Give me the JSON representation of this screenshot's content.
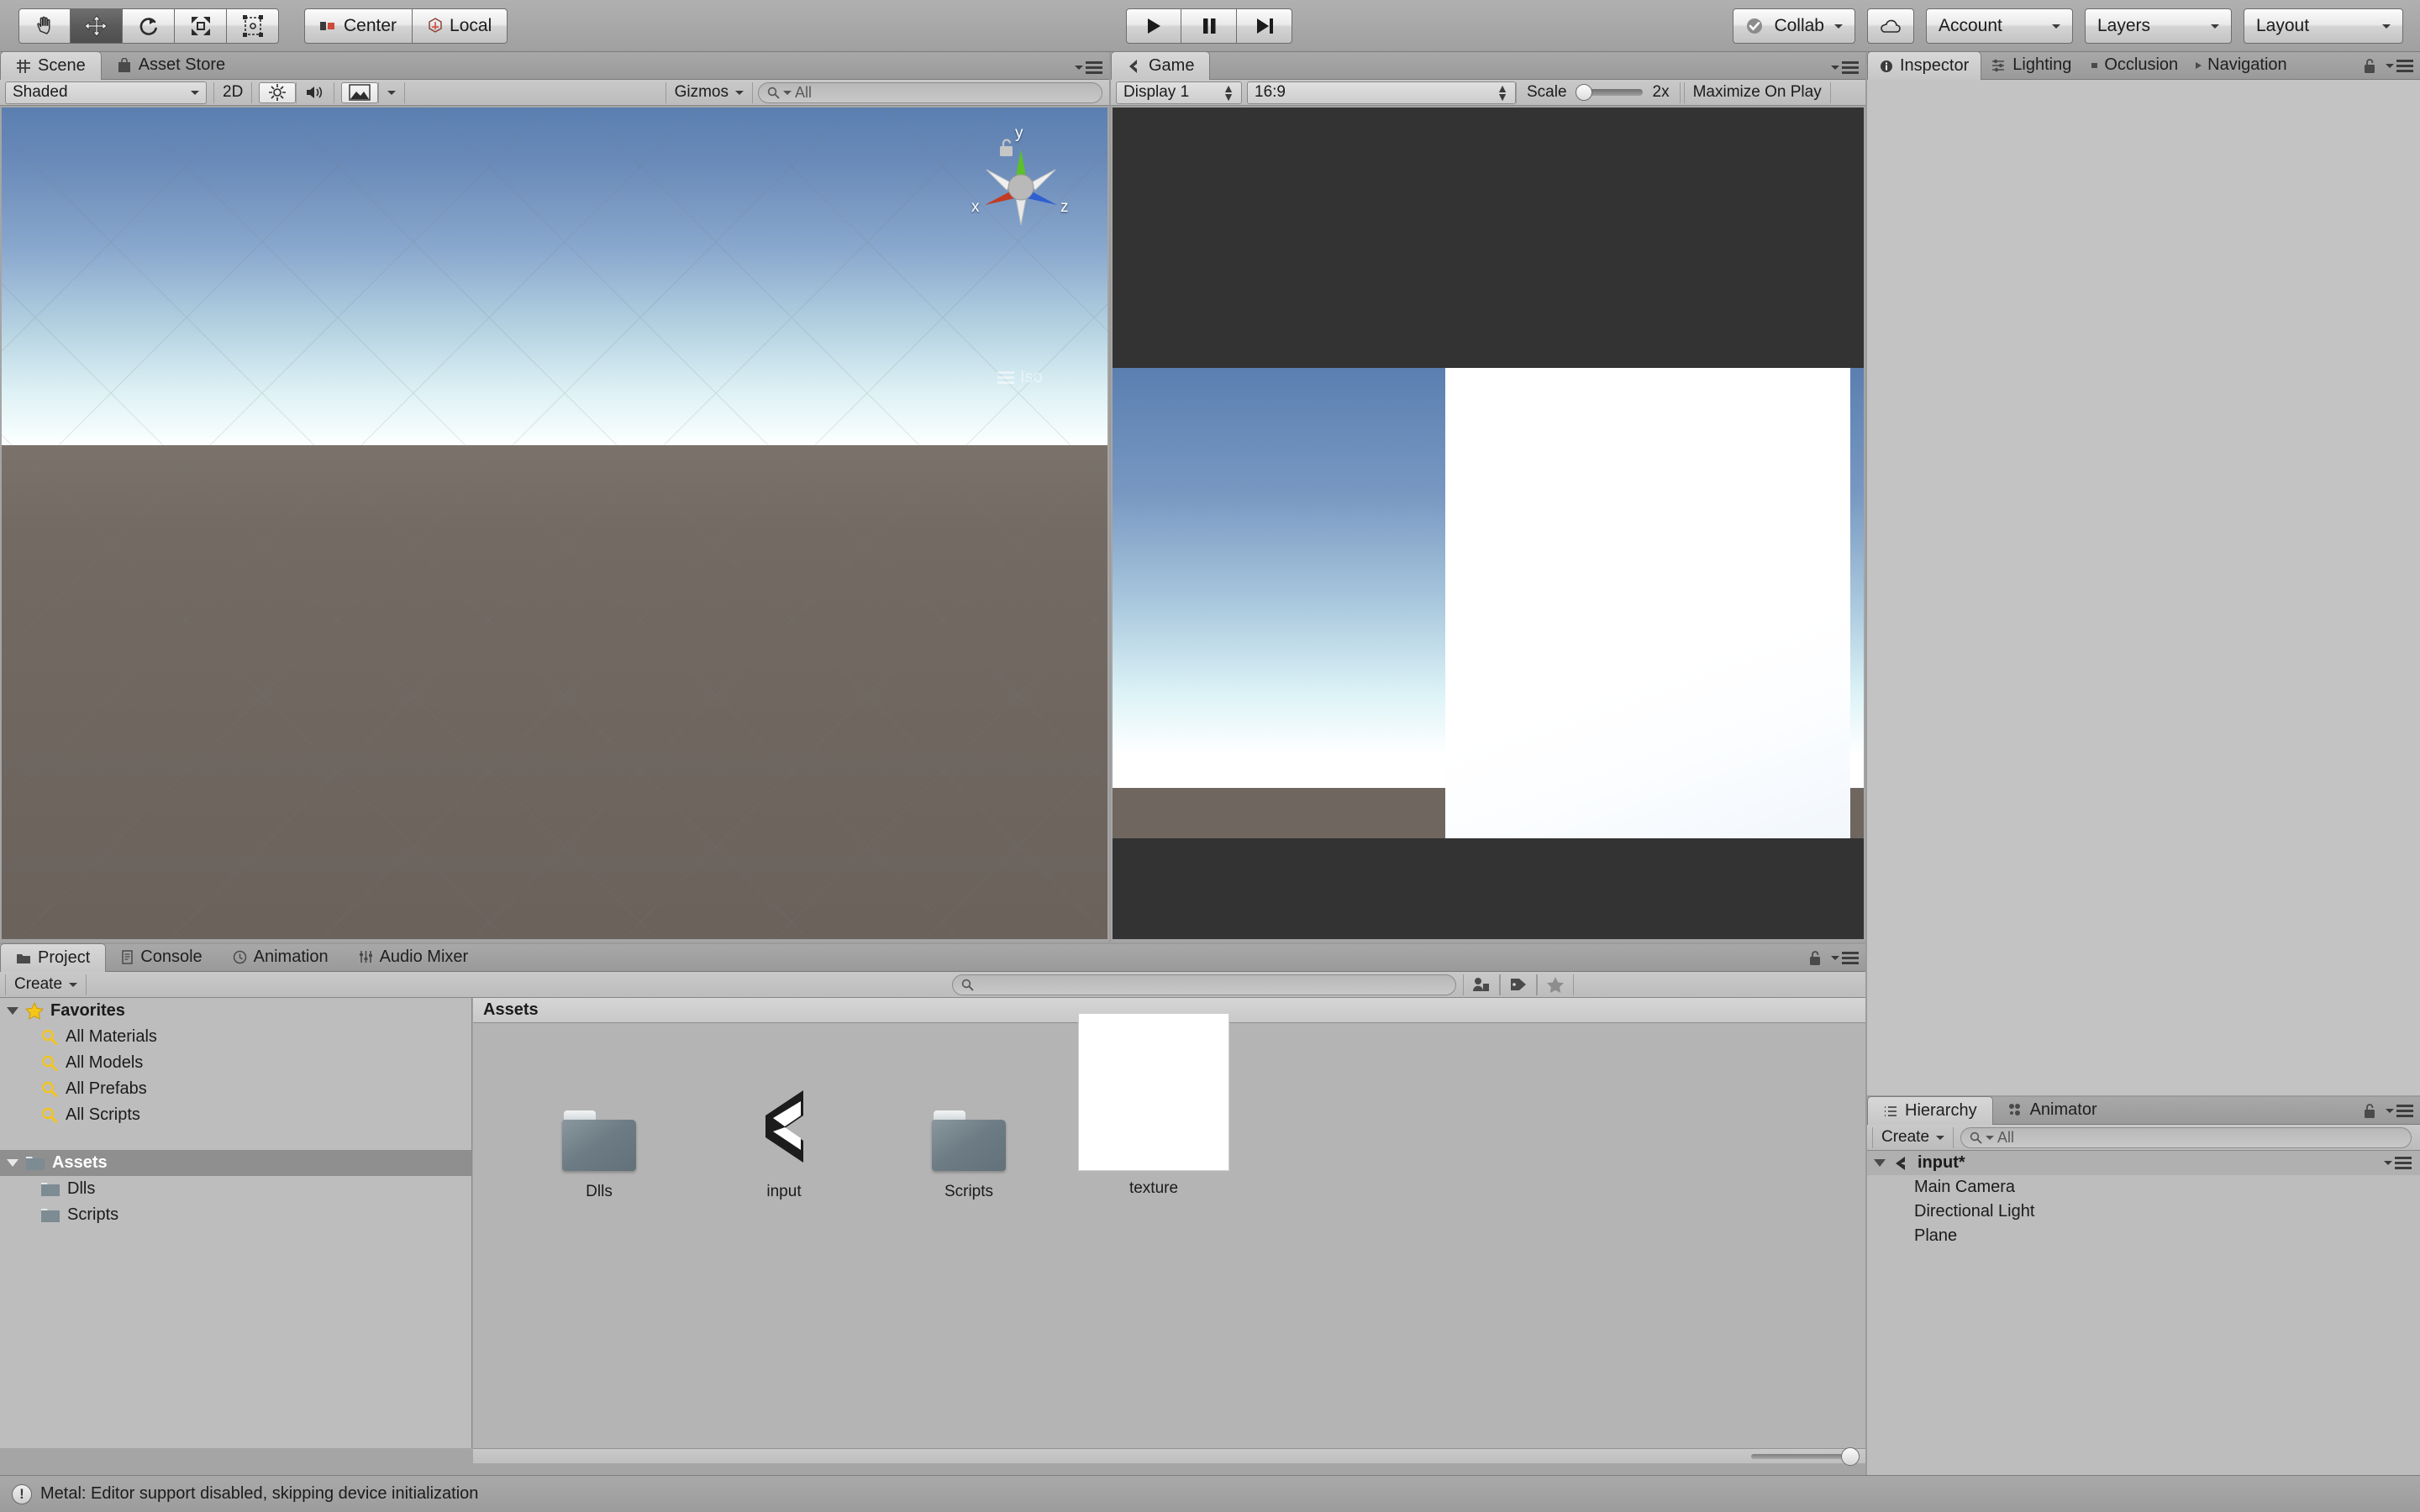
{
  "toolbar": {
    "tools": [
      {
        "name": "hand-tool",
        "icon": "hand-icon",
        "selected": false
      },
      {
        "name": "move-tool",
        "icon": "move-icon",
        "selected": true
      },
      {
        "name": "rotate-tool",
        "icon": "rotate-icon",
        "selected": false
      },
      {
        "name": "scale-tool",
        "icon": "scale-icon",
        "selected": false
      },
      {
        "name": "rect-tool",
        "icon": "rect-transform-icon",
        "selected": false
      }
    ],
    "pivot_label": "Center",
    "pivot_icon": "pivot-center-icon",
    "handle_label": "Local",
    "handle_icon": "handle-local-icon",
    "play_label": "play-icon",
    "pause_label": "pause-icon",
    "step_label": "step-icon",
    "collab_label": "Collab",
    "collab_icon": "collab-check-icon",
    "cloud_icon": "cloud-icon",
    "account_label": "Account",
    "layers_label": "Layers",
    "layout_label": "Layout"
  },
  "scene_panel": {
    "tabs": [
      {
        "label": "Scene",
        "icon": "scene-grid-icon",
        "active": true
      },
      {
        "label": "Asset Store",
        "icon": "asset-store-icon",
        "active": false
      }
    ],
    "draw_mode": "Shaded",
    "mode_2d": "2D",
    "lighting_icon": "light-toggle-icon",
    "audio_icon": "audio-toggle-icon",
    "effects_icon": "effects-icon",
    "gizmos_label": "Gizmos",
    "search_placeholder": "All",
    "search_value": "",
    "search_icon": "search-icon",
    "axis_x": "x",
    "axis_y": "y",
    "axis_z": "z",
    "projection_label": "Iso",
    "lock_icon": "lock-open-icon",
    "menu_icon": "panel-menu-icon"
  },
  "game_panel": {
    "tabs": [
      {
        "label": "Game",
        "icon": "game-unity-icon",
        "active": true
      }
    ],
    "display_label": "Display 1",
    "aspect_label": "16:9",
    "scale_label": "Scale",
    "scale_value": "2x",
    "maximize_label": "Maximize On Play",
    "menu_icon": "panel-menu-icon"
  },
  "inspector_panel": {
    "tabs": [
      {
        "label": "Inspector",
        "icon": "inspector-info-icon",
        "active": true
      },
      {
        "label": "Lighting",
        "icon": "lighting-sliders-icon",
        "active": false
      },
      {
        "label": "Occlusion",
        "icon": "occlusion-icon",
        "active": false
      },
      {
        "label": "Navigation",
        "icon": "navigation-icon",
        "active": false
      }
    ],
    "lock_icon": "lock-open-icon",
    "menu_icon": "panel-menu-icon"
  },
  "project_panel": {
    "tabs": [
      {
        "label": "Project",
        "icon": "project-folder-icon",
        "active": true
      },
      {
        "label": "Console",
        "icon": "console-icon",
        "active": false
      },
      {
        "label": "Animation",
        "icon": "animation-clock-icon",
        "active": false
      },
      {
        "label": "Audio Mixer",
        "icon": "audio-mixer-icon",
        "active": false
      }
    ],
    "create_label": "Create",
    "search_placeholder": "",
    "search_value": "",
    "search_icon": "search-icon",
    "filter_type_icon": "filter-by-type-icon",
    "filter_label_icon": "filter-by-label-icon",
    "filter_favorite_icon": "filter-favorite-star-icon",
    "lock_icon": "lock-open-icon",
    "menu_icon": "panel-menu-icon",
    "tree": [
      {
        "label": "Favorites",
        "icon": "favorites-star-icon",
        "depth": 0,
        "expanded": true,
        "bold": true,
        "selected": false
      },
      {
        "label": "All Materials",
        "icon": "saved-search-icon",
        "depth": 1,
        "expanded": null,
        "bold": false,
        "selected": false
      },
      {
        "label": "All Models",
        "icon": "saved-search-icon",
        "depth": 1,
        "expanded": null,
        "bold": false,
        "selected": false
      },
      {
        "label": "All Prefabs",
        "icon": "saved-search-icon",
        "depth": 1,
        "expanded": null,
        "bold": false,
        "selected": false
      },
      {
        "label": "All Scripts",
        "icon": "saved-search-icon",
        "depth": 1,
        "expanded": null,
        "bold": false,
        "selected": false
      },
      {
        "label": "Assets",
        "icon": "folder-icon",
        "depth": 0,
        "expanded": true,
        "bold": true,
        "selected": true
      },
      {
        "label": "Dlls",
        "icon": "folder-icon",
        "depth": 1,
        "expanded": null,
        "bold": false,
        "selected": false
      },
      {
        "label": "Scripts",
        "icon": "folder-icon",
        "depth": 1,
        "expanded": null,
        "bold": false,
        "selected": false
      }
    ],
    "breadcrumb": "Assets",
    "assets": [
      {
        "name": "Dlls",
        "kind": "folder"
      },
      {
        "name": "input",
        "kind": "scene"
      },
      {
        "name": "Scripts",
        "kind": "folder"
      },
      {
        "name": "texture",
        "kind": "texture"
      }
    ]
  },
  "hierarchy_panel": {
    "tabs": [
      {
        "label": "Hierarchy",
        "icon": "hierarchy-list-icon",
        "active": true
      },
      {
        "label": "Animator",
        "icon": "animator-icon",
        "active": false
      }
    ],
    "create_label": "Create",
    "search_placeholder": "All",
    "search_value": "",
    "search_icon": "search-icon",
    "lock_icon": "lock-open-icon",
    "menu_icon": "panel-menu-icon",
    "scene_name": "input*",
    "scene_icon": "unity-scene-icon",
    "objects": [
      {
        "label": "Main Camera"
      },
      {
        "label": "Directional Light"
      },
      {
        "label": "Plane"
      }
    ]
  },
  "status_bar": {
    "icon": "warning-icon",
    "message": "Metal: Editor support disabled, skipping device initialization"
  },
  "colors": {
    "chrome": "#9b9b9b",
    "panel_bg": "#a5a5a5",
    "tab_active": "#d0d0d0",
    "sky_top": "#5a7fb0",
    "sky_horizon": "#f2fbfd",
    "ground": "#6f6660",
    "game_letterbox": "#333333",
    "selection": "#8f8f8f",
    "axis_x": "#c23b22",
    "axis_y": "#5cc028",
    "axis_z": "#2f5fd0",
    "favorite_star": "#f5c518"
  }
}
